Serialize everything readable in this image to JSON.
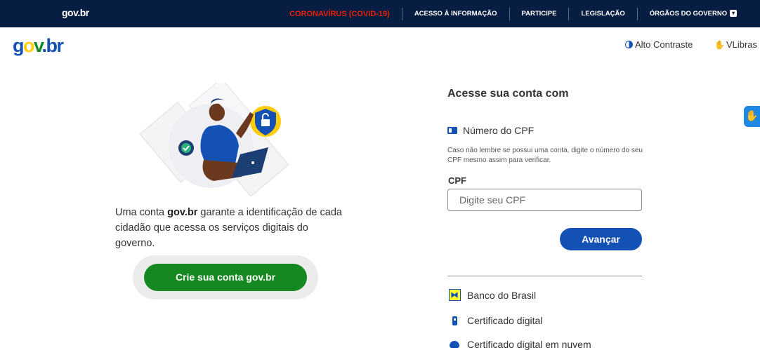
{
  "topbar": {
    "brand": "gov.br",
    "nav": [
      "CORONAVÍRUS (COVID-19)",
      "ACESSO À INFORMAÇÃO",
      "PARTICIPE",
      "LEGISLAÇÃO",
      "ÓRGÃOS DO GOVERNO"
    ],
    "colors": {
      "background": "#071d41",
      "covid": "#e52207"
    }
  },
  "header": {
    "logo": {
      "g": "g",
      "o": "o",
      "v": "v",
      "dot": ".",
      "br": "br"
    },
    "contrast_label": "Alto Contraste",
    "vlibras_label": "VLibras"
  },
  "left": {
    "tagline_pre": "Uma conta ",
    "tagline_bold": "gov.br",
    "tagline_post": " garante a identificação de cada cidadão que acessa os serviços digitais do governo.",
    "create_button": "Crie sua conta gov.br"
  },
  "login": {
    "title": "Acesse sua conta com",
    "cpf_option": "Número do CPF",
    "hint": "Caso não lembre se possui uma conta, digite o número do seu CPF mesmo assim para verificar.",
    "cpf_label": "CPF",
    "cpf_placeholder": "Digite seu CPF",
    "cpf_value": "",
    "next_button": "Avançar",
    "other_options": [
      "Banco do Brasil",
      "Certificado digital",
      "Certificado digital em nuvem"
    ]
  },
  "colors": {
    "primary_blue": "#1351b4",
    "green": "#168821",
    "yellow": "#ffcd07"
  }
}
